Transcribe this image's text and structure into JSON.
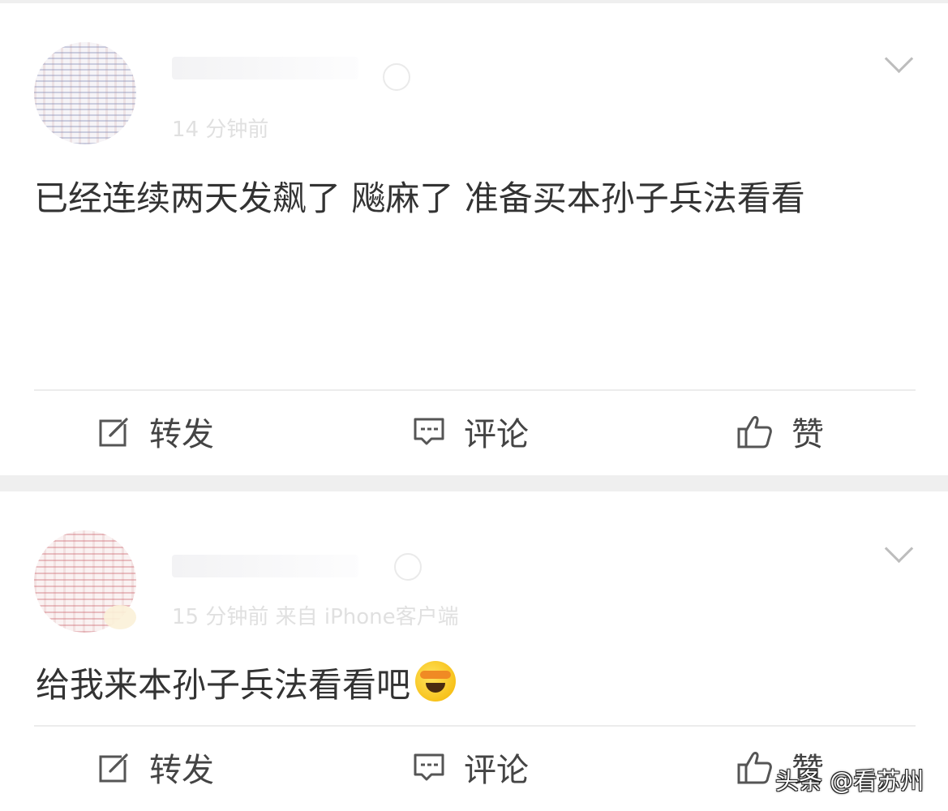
{
  "posts": [
    {
      "meta": "14 分钟前",
      "text": "已经连续两天发飙了  飚麻了 准备买本孙子兵法看看",
      "actions": {
        "repost": "转发",
        "comment": "评论",
        "like": "赞"
      }
    },
    {
      "meta": "15 分钟前  来自 iPhone客户端",
      "text": "给我来本孙子兵法看看吧",
      "actions": {
        "repost": "转发",
        "comment": "评论",
        "like": "赞"
      }
    }
  ],
  "watermark": "头条 @看苏州",
  "icons": {
    "repost": "edit-share-icon",
    "comment": "comment-bubble-icon",
    "like": "thumbs-up-icon",
    "menu": "chevron-down-icon",
    "emoji": "laughing-crying-emoji-icon"
  }
}
